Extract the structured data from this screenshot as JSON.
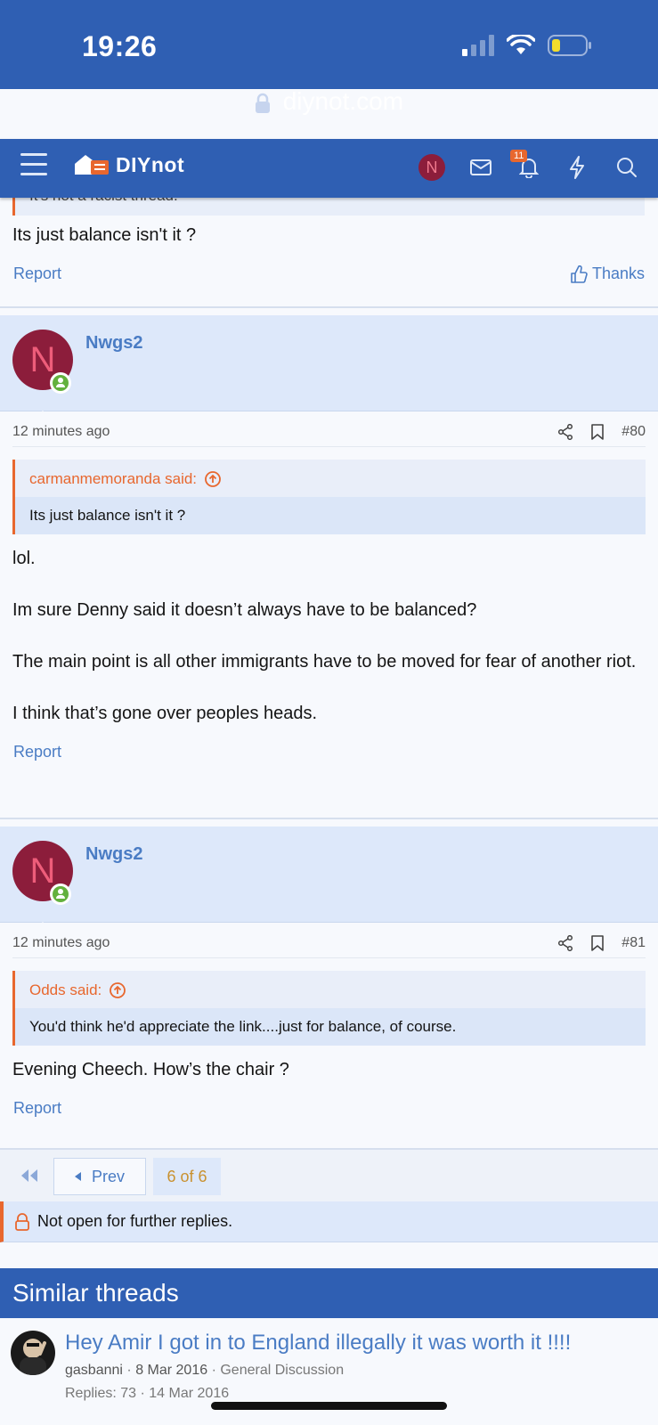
{
  "status_bar": {
    "time": "19:26"
  },
  "browser": {
    "url": "diynot.com"
  },
  "header": {
    "logo_text": "DIYnot",
    "avatar_letter": "N",
    "notification_count": "11",
    "icons": [
      "menu-icon",
      "mail-icon",
      "bell-icon",
      "lightning-icon",
      "search-icon"
    ]
  },
  "prev_post": {
    "quote_partial": "It's not a racist thread.",
    "text": "Its just balance isn't it ?",
    "report": "Report",
    "thanks": "Thanks"
  },
  "posts": [
    {
      "username": "Nwgs2",
      "avatar_letter": "N",
      "time": "12 minutes ago",
      "number": "#80",
      "quote_author": "carmanmemoranda said:",
      "quote_text": "Its just balance isn't it ?",
      "body": [
        "lol.",
        "Im sure Denny said it doesn’t always have to be balanced?",
        "The main point is all other immigrants have to be moved for fear of another riot.",
        "I think that’s gone over peoples heads."
      ],
      "report": "Report"
    },
    {
      "username": "Nwgs2",
      "avatar_letter": "N",
      "time": "12 minutes ago",
      "number": "#81",
      "quote_author": "Odds said:",
      "quote_text": "You'd think he'd appreciate the link....just for balance, of course.",
      "body": [
        "Evening Cheech. How’s the chair ?"
      ],
      "report": "Report"
    }
  ],
  "pagination": {
    "prev": "Prev",
    "current": "6 of 6"
  },
  "closed_notice": "Not open for further replies.",
  "similar_threads": {
    "heading": "Similar threads",
    "items": [
      {
        "title": "Hey Amir I got in to England illegally it was worth it !!!!",
        "author": "gasbanni",
        "date": "8 Mar 2016",
        "forum": "General Discussion",
        "replies": "Replies: 73",
        "last_date": "14 Mar 2016"
      }
    ]
  },
  "colors": {
    "brand": "#2f5fb3",
    "accent": "#e8672e",
    "link": "#4a7cc4",
    "online": "#63b13d"
  }
}
